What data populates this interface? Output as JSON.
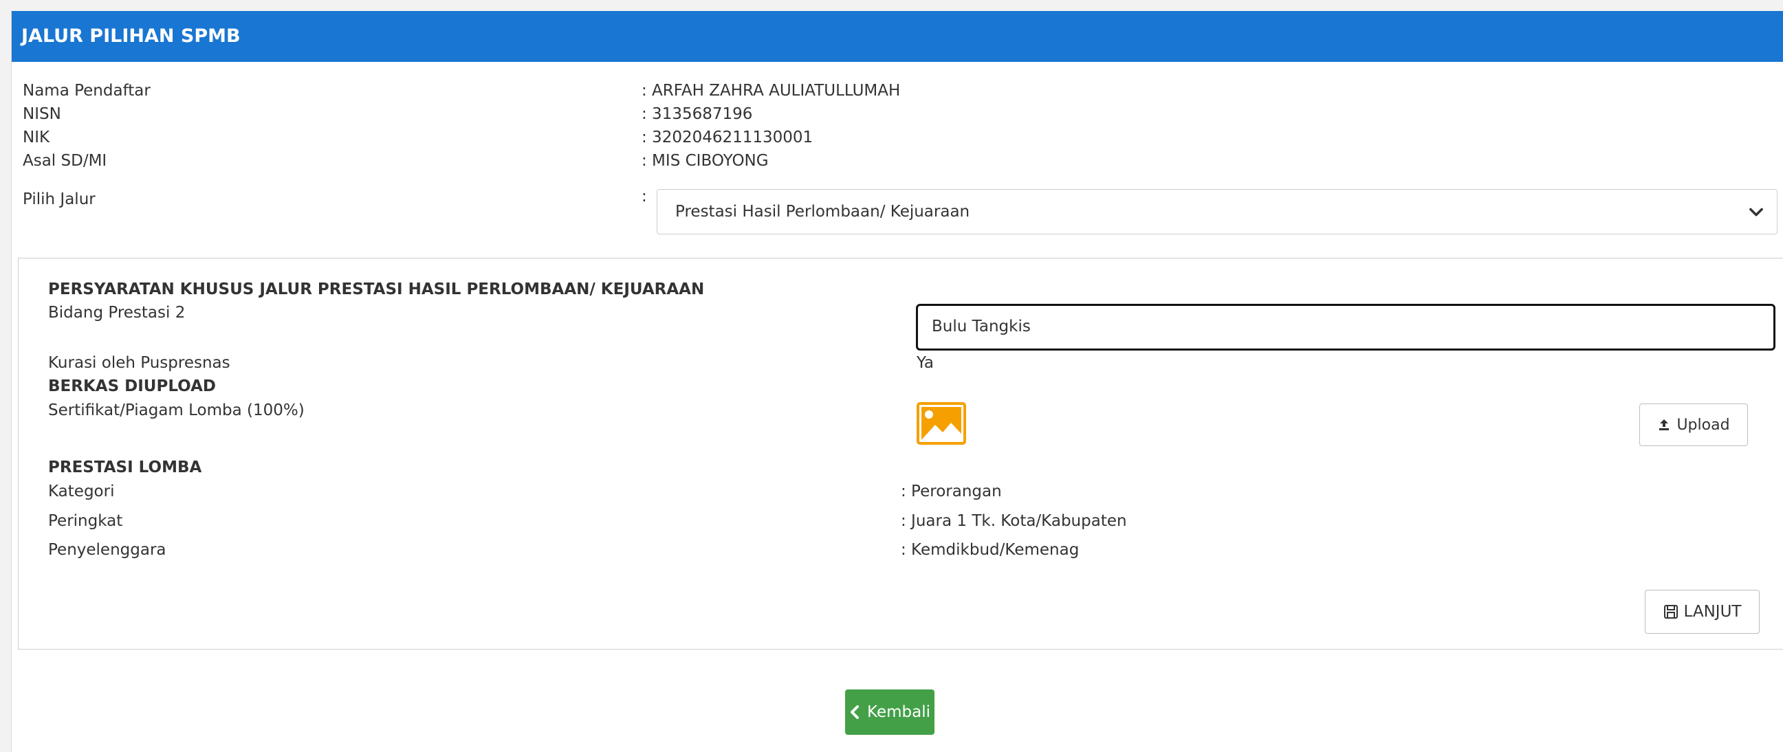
{
  "header": {
    "title": "JALUR PILIHAN SPMB"
  },
  "applicant": [
    {
      "label": "Nama Pendaftar",
      "value": ": ARFAH ZAHRA AULIATULLUMAH"
    },
    {
      "label": "NISN",
      "value": ": 3135687196"
    },
    {
      "label": "NIK",
      "value": ": 3202046211130001"
    },
    {
      "label": "Asal SD/MI",
      "value": ": MIS CIBOYONG"
    },
    {
      "label": "Pilih Jalur",
      "value": ":"
    }
  ],
  "jalur_select": {
    "selected": "Prestasi Hasil Perlombaan/ Kejuaraan",
    "icon": "chevron-down-icon"
  },
  "requirements": {
    "heading": "PERSYARATAN KHUSUS JALUR PRESTASI HASIL PERLOMBAAN/ KEJUARAAN",
    "bidang_label": "Bidang Prestasi 2",
    "bidang_value": "Bulu Tangkis",
    "kurasi_label": "Kurasi oleh Puspresnas",
    "kurasi_value": "Ya"
  },
  "uploads": {
    "heading": "BERKAS DIUPLOAD",
    "file_label": "Sertifikat/Piagam Lomba (100%)",
    "file_icon": "image-icon",
    "upload_label": "Upload",
    "upload_icon": "upload-icon"
  },
  "prestasi": {
    "heading": "PRESTASI LOMBA",
    "rows": [
      {
        "label": "Kategori",
        "value": ": Perorangan"
      },
      {
        "label": "Peringkat",
        "value": ": Juara 1 Tk. Kota/Kabupaten"
      },
      {
        "label": "Penyelenggara",
        "value": ": Kemdikbud/Kemenag"
      }
    ]
  },
  "actions": {
    "lanjut_label": "LANJUT",
    "lanjut_icon": "save-icon",
    "back_label": "Kembali",
    "back_icon": "chevron-left-icon"
  },
  "colors": {
    "header_bg": "#1976d2",
    "back_button_bg": "#43a047",
    "image_icon": "#f5a000"
  }
}
